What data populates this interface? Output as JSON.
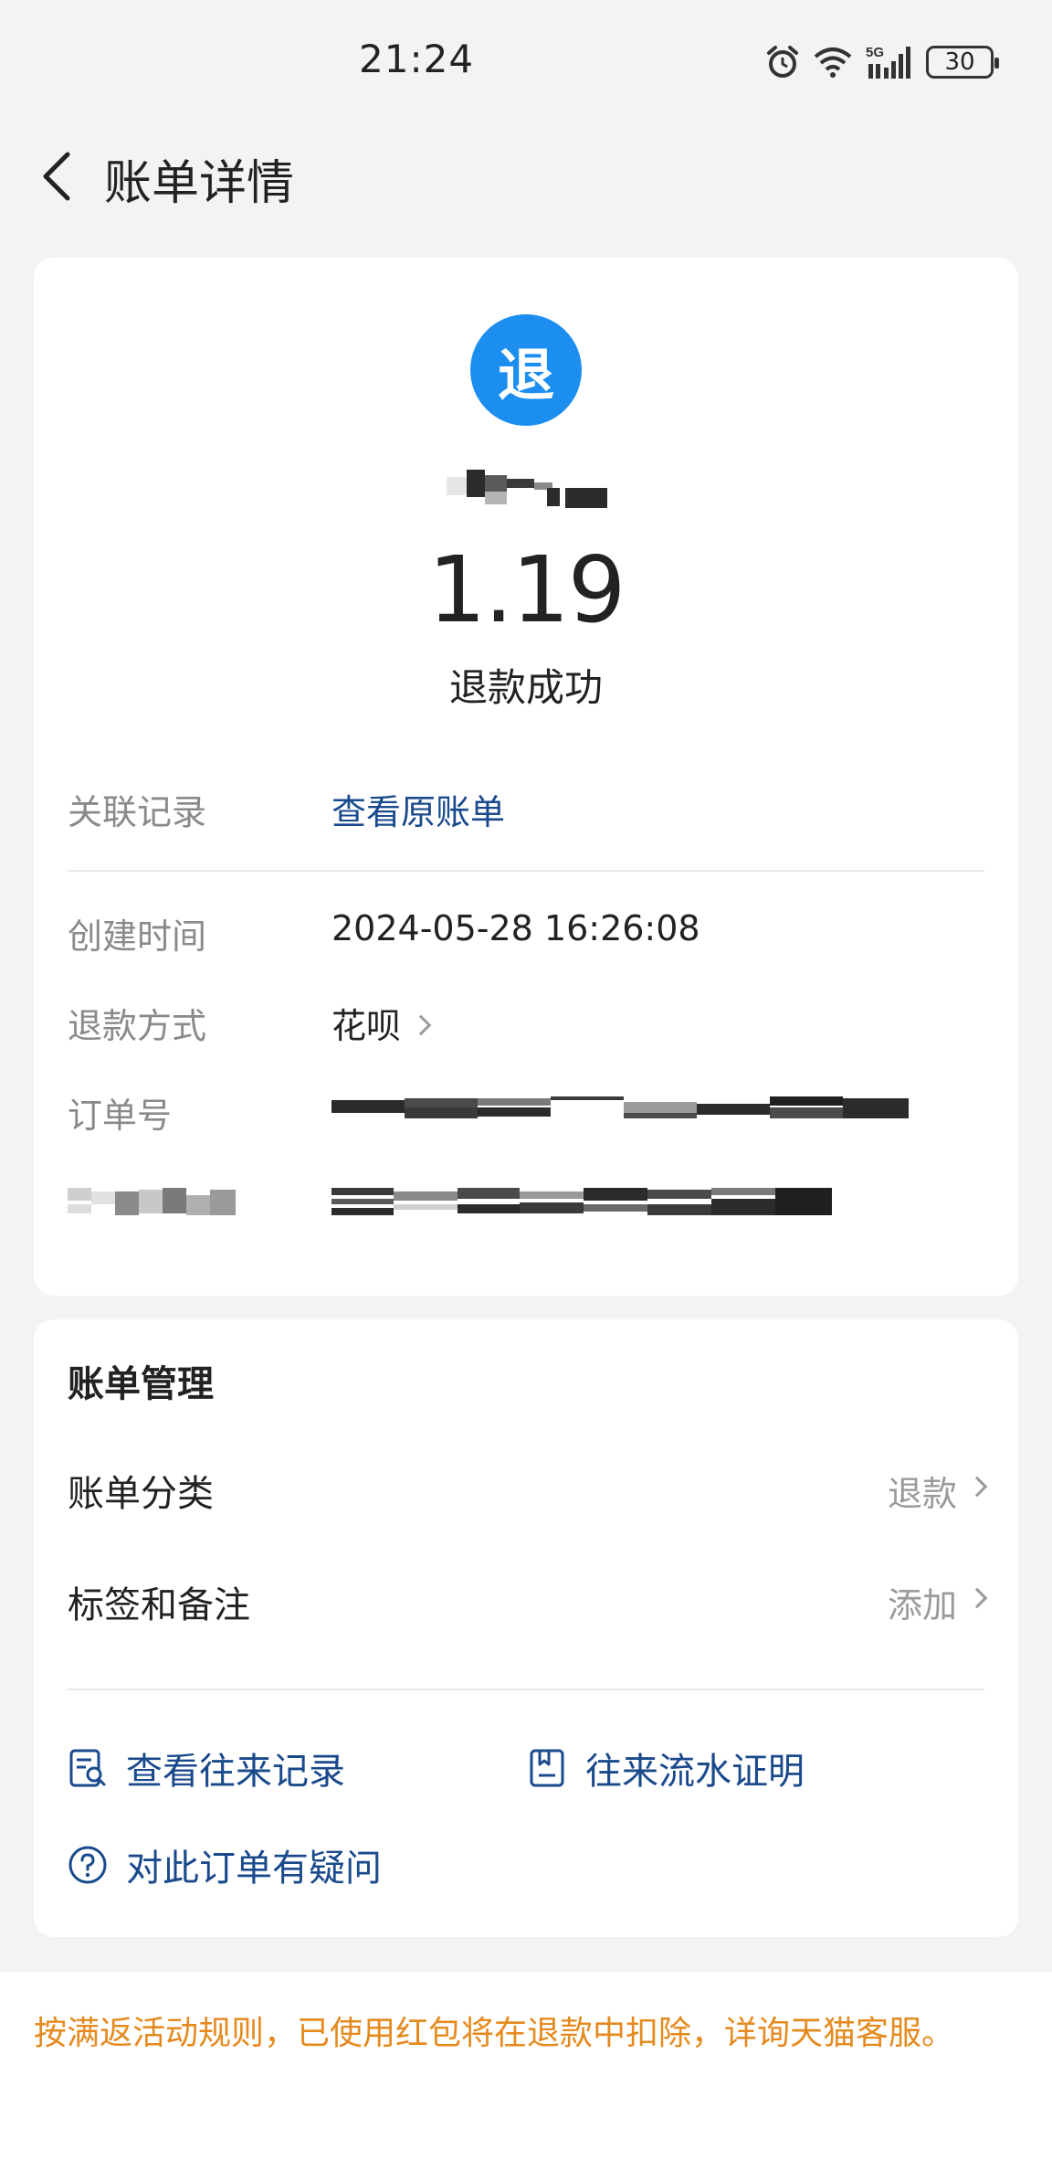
{
  "status_bar": {
    "time": "21:24",
    "network": "5G",
    "battery": "30",
    "icons": [
      "alarm-icon",
      "wifi-icon",
      "signal-icon",
      "battery-icon"
    ]
  },
  "header": {
    "title": "账单详情",
    "back_icon": "chevron-left-icon"
  },
  "summary": {
    "badge": "退",
    "badge_color": "#1b8ef0",
    "amount": "1.19",
    "status": "退款成功"
  },
  "details": {
    "related_label": "关联记录",
    "related_value": "查看原账单",
    "created_label": "创建时间",
    "created_value": "2024-05-28 16:26:08",
    "method_label": "退款方式",
    "method_value": "花呗",
    "order_label": "订单号"
  },
  "management": {
    "title": "账单管理",
    "category_label": "账单分类",
    "category_value": "退款",
    "tags_label": "标签和备注",
    "tags_value": "添加",
    "actions": {
      "history": "查看往来记录",
      "proof": "往来流水证明",
      "question": "对此订单有疑问"
    }
  },
  "notice": {
    "text": "按满返活动规则，已使用红包将在退款中扣除，详询天猫客服。",
    "color": "#e58a1e"
  },
  "colors": {
    "link": "#1a4a8c",
    "background": "#f3f3f3"
  }
}
